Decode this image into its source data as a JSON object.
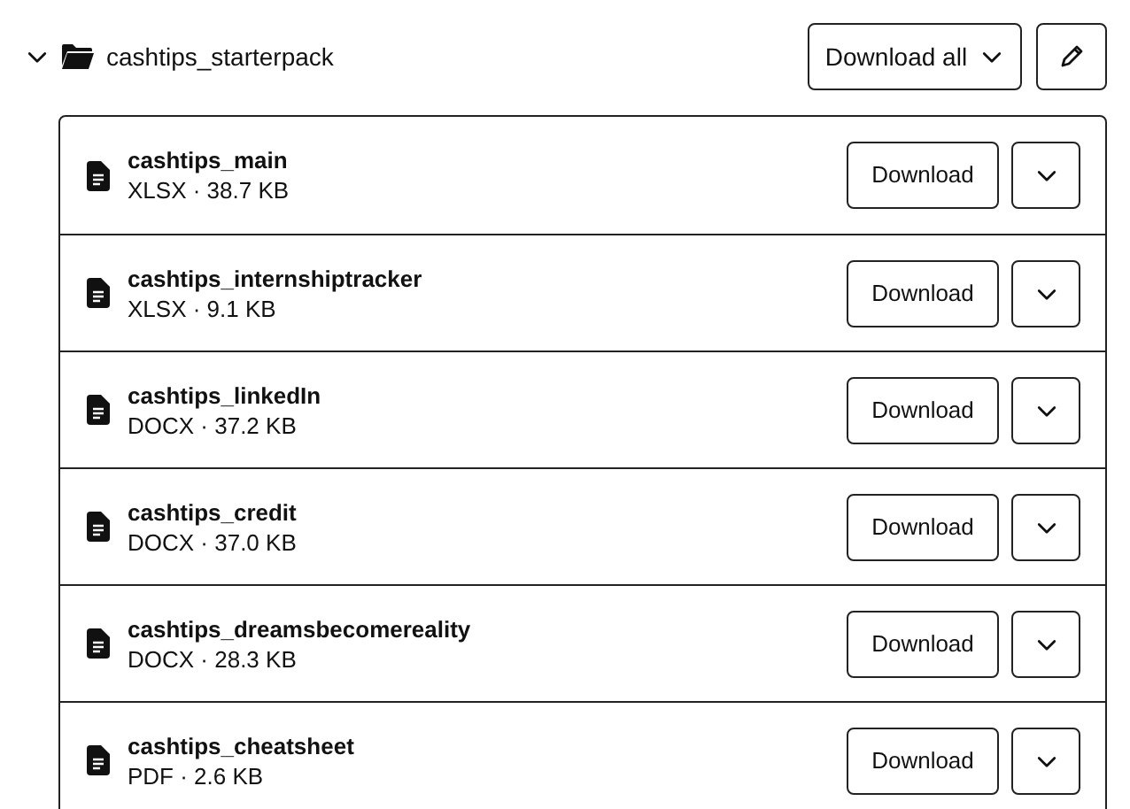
{
  "folder": {
    "name": "cashtips_starterpack",
    "expanded": true,
    "download_all": "Download all"
  },
  "files": [
    {
      "name": "cashtips_main",
      "meta": "XLSX · 38.7 KB",
      "download": "Download"
    },
    {
      "name": "cashtips_internshiptracker",
      "meta": "XLSX · 9.1 KB",
      "download": "Download"
    },
    {
      "name": "cashtips_linkedIn",
      "meta": "DOCX · 37.2 KB",
      "download": "Download"
    },
    {
      "name": "cashtips_credit",
      "meta": "DOCX · 37.0 KB",
      "download": "Download"
    },
    {
      "name": "cashtips_dreamsbecomereality",
      "meta": "DOCX · 28.3 KB",
      "download": "Download"
    },
    {
      "name": "cashtips_cheatsheet",
      "meta": "PDF · 2.6 KB",
      "download": "Download"
    }
  ]
}
